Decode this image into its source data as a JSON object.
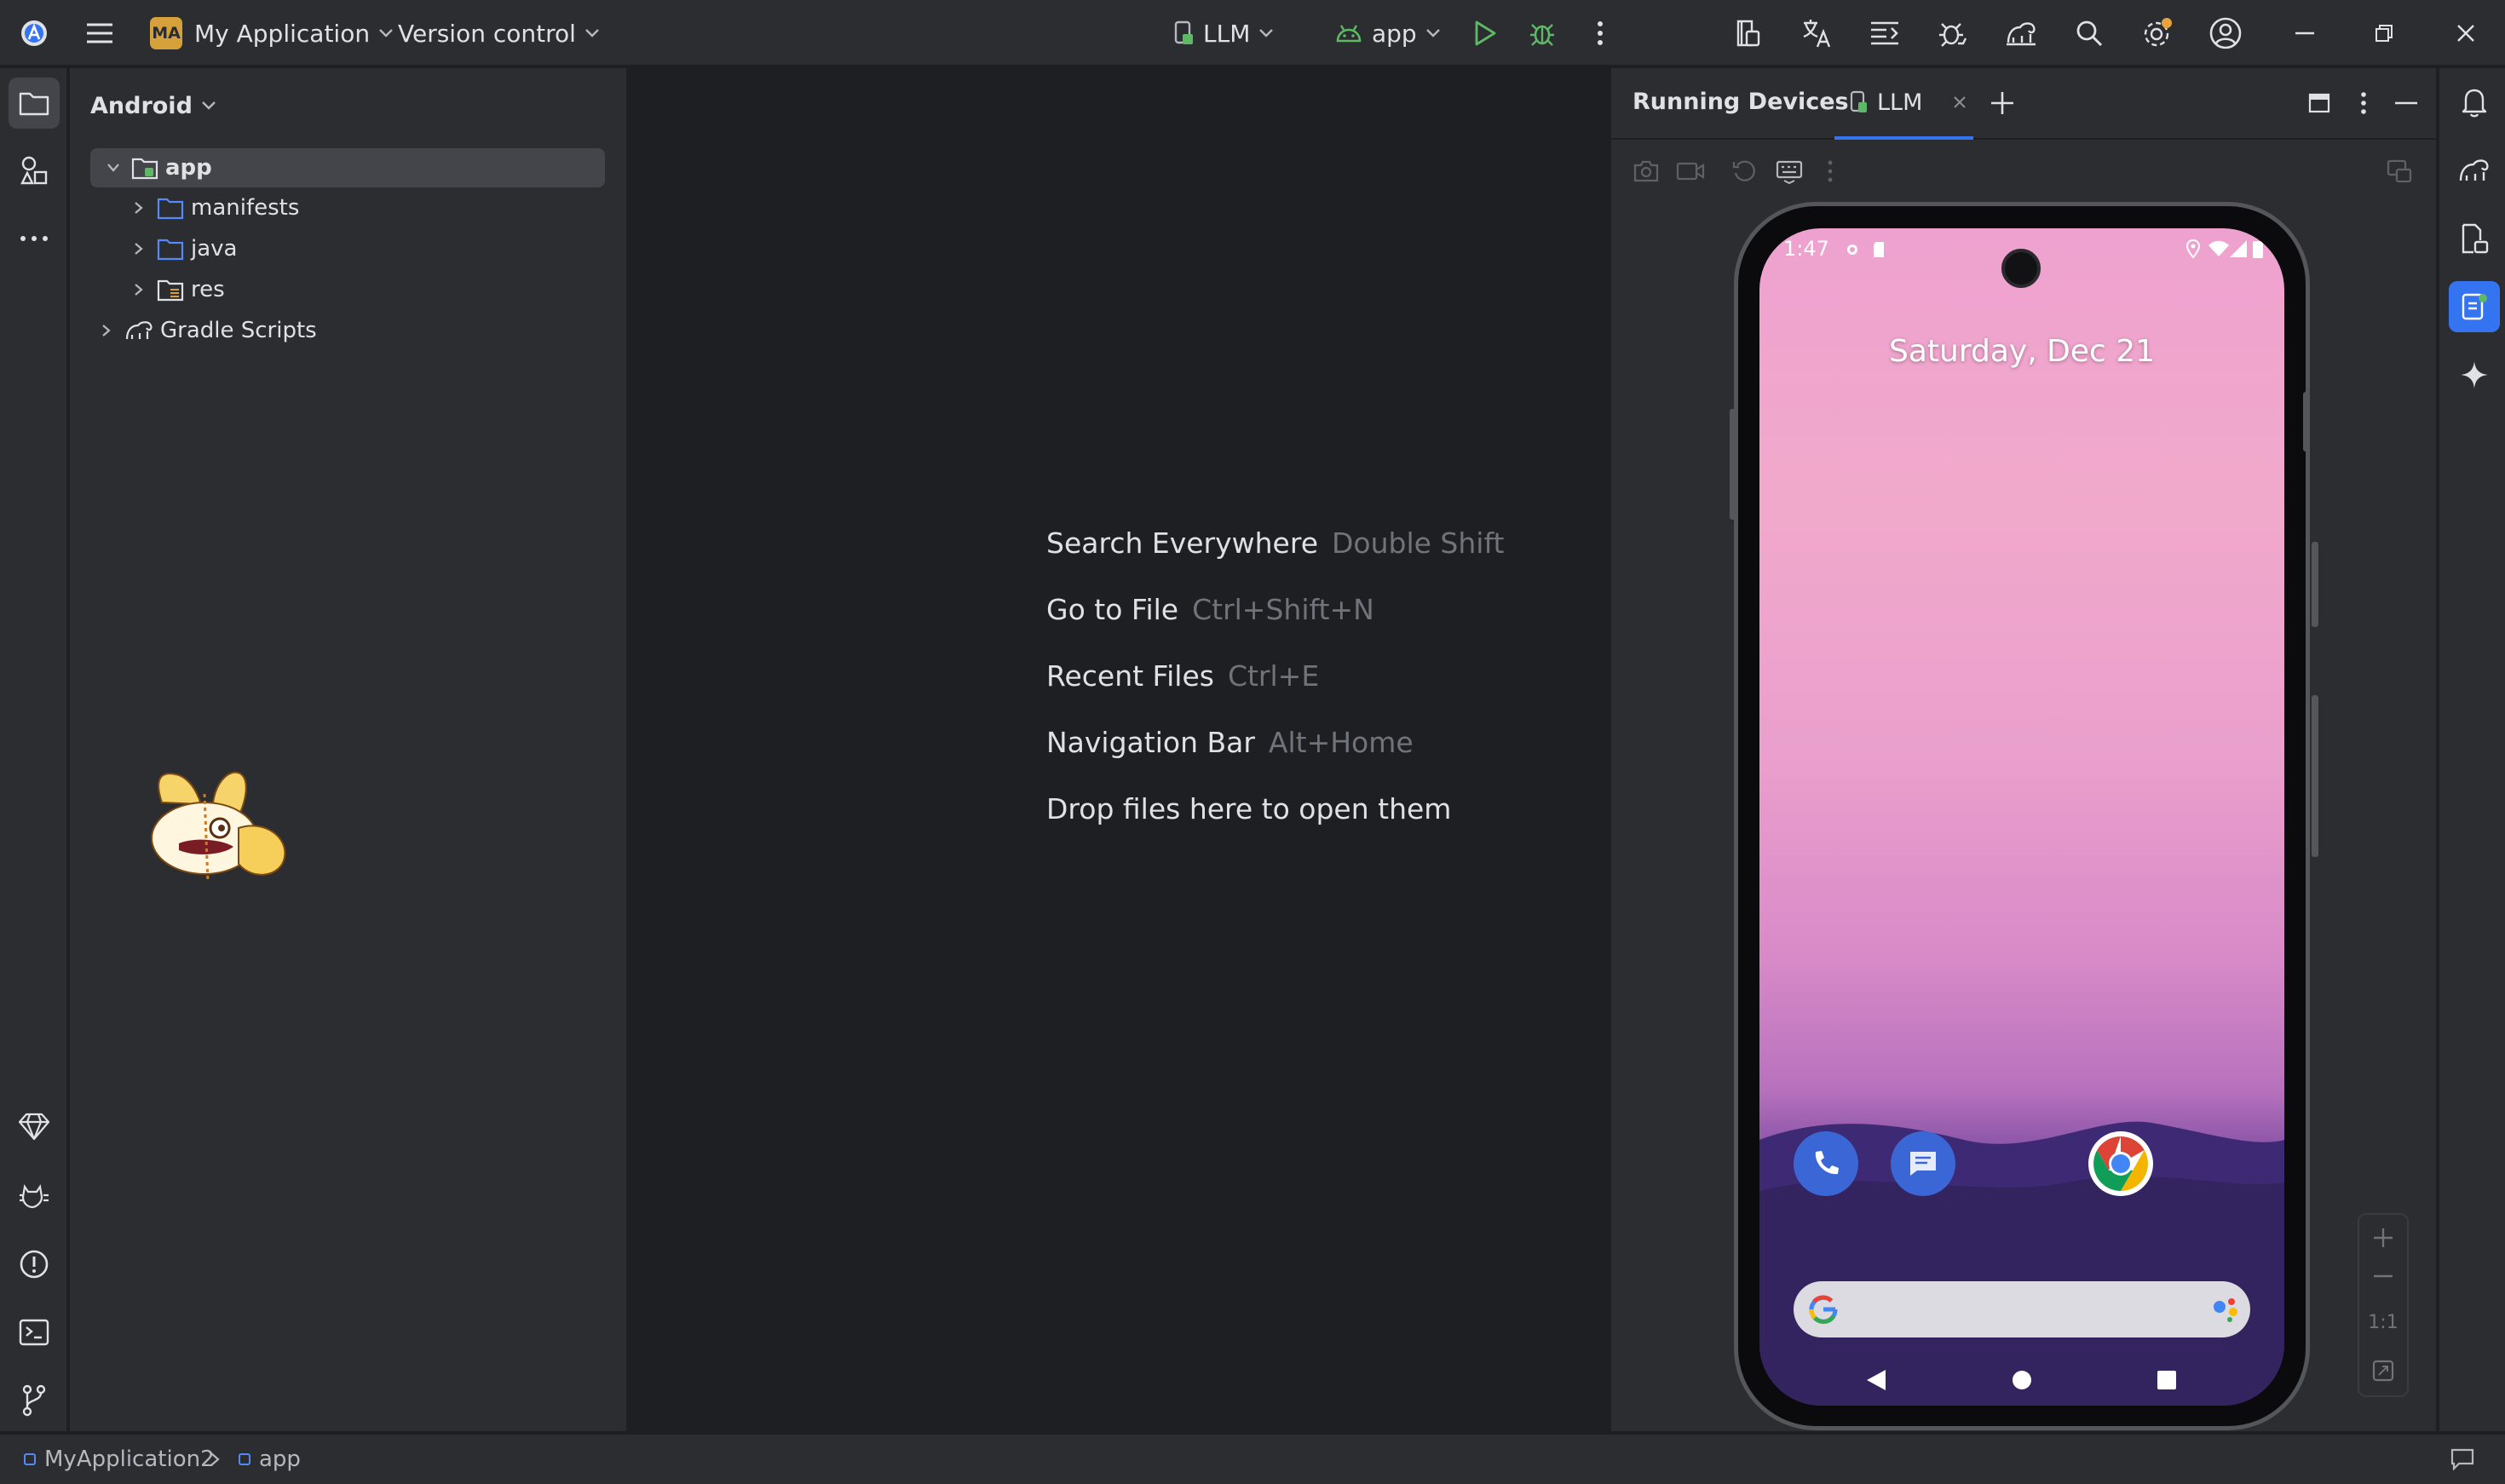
{
  "titlebar": {
    "project_badge": "MA",
    "project_name": "My Application",
    "vcs_label": "Version control",
    "device_selector": "LLM",
    "run_config": "app"
  },
  "project_panel": {
    "view_mode": "Android",
    "tree": [
      {
        "label": "app",
        "level": 0,
        "expanded": true,
        "selected": true
      },
      {
        "label": "manifests",
        "level": 1,
        "expanded": false
      },
      {
        "label": "java",
        "level": 1,
        "expanded": false
      },
      {
        "label": "res",
        "level": 1,
        "expanded": false
      },
      {
        "label": "Gradle Scripts",
        "level": 0,
        "expanded": false
      }
    ]
  },
  "editor": {
    "hints": [
      {
        "action": "Search Everywhere",
        "shortcut": "Double Shift"
      },
      {
        "action": "Go to File",
        "shortcut": "Ctrl+Shift+N"
      },
      {
        "action": "Recent Files",
        "shortcut": "Ctrl+E"
      },
      {
        "action": "Navigation Bar",
        "shortcut": "Alt+Home"
      },
      {
        "action": "Drop files here to open them",
        "shortcut": ""
      }
    ]
  },
  "running_devices": {
    "title": "Running Devices",
    "tab_label": "LLM",
    "phone": {
      "time": "1:47",
      "date": "Saturday, Dec 21",
      "apps": [
        "phone-icon",
        "messages-icon",
        "chrome-icon"
      ]
    },
    "zoom": {
      "ratio_label": "1:1"
    }
  },
  "statusbar": {
    "breadcrumb": [
      "MyApplication2",
      "app"
    ]
  },
  "colors": {
    "accent": "#3574f0",
    "run_green": "#5fb865",
    "badge": "#d6a13a",
    "notification_dot": "#e8a33d"
  }
}
